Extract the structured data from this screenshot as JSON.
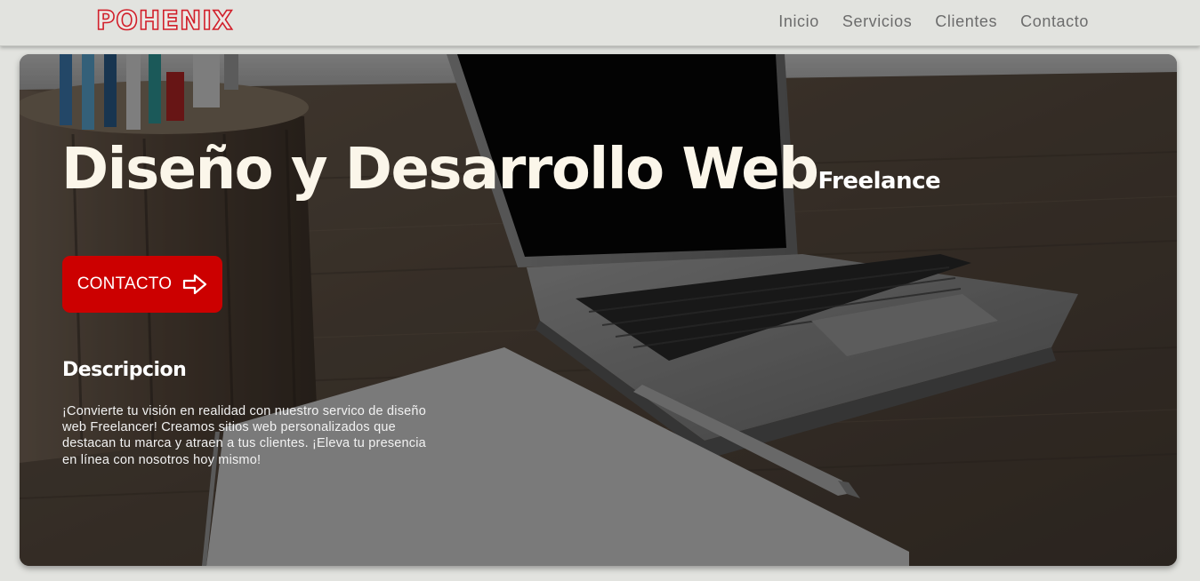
{
  "brand": {
    "name": "POHENIX",
    "color": "#d11f2a"
  },
  "nav": {
    "links": [
      {
        "label": "Inicio"
      },
      {
        "label": "Servicios"
      },
      {
        "label": "Clientes"
      },
      {
        "label": "Contacto"
      }
    ]
  },
  "hero": {
    "title": "Diseño y Desarrollo Web",
    "title_suffix": "Freelance",
    "cta_label": "CONTACTO",
    "cta_icon": "arrow-right-icon",
    "cta_color": "#cc0000",
    "description_title": "Descripcion",
    "description": "¡Convierte tu visión en realidad con nuestro servico de diseño web Freelancer! Creamos sitios web personalizados que destacan tu marca y atraen a tus clientes. ¡Eleva tu presencia en línea con nosotros hoy mismo!"
  }
}
